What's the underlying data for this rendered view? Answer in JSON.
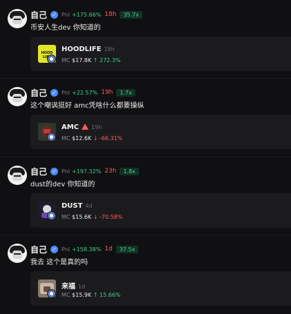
{
  "posts": [
    {
      "username": "自己",
      "pnl_label": "Pnl",
      "pnl": "+175.66%",
      "age": "18h",
      "multiplier": "35.7x",
      "message": "币安人生dev 你知道的",
      "token": {
        "name": "HOODLIFE",
        "age": "18h",
        "mc_label": "MC",
        "mc": "$17.8K",
        "change_arrow": "↑",
        "change": "272.3%",
        "direction": "up",
        "warning": false,
        "image_label": "HOOD LIFE"
      }
    },
    {
      "username": "自己",
      "pnl_label": "Pnl",
      "pnl": "+22.57%",
      "age": "19h",
      "multiplier": "1.7x",
      "message": "这个嘲讽挺好 amc凭啥什么都要操纵",
      "token": {
        "name": "AMC",
        "age": "19h",
        "mc_label": "MC",
        "mc": "$12.6K",
        "change_arrow": "↓",
        "change": "-66.31%",
        "direction": "down",
        "warning": true
      }
    },
    {
      "username": "自己",
      "pnl_label": "Pnl",
      "pnl": "+197.32%",
      "age": "23h",
      "multiplier": "1.8x",
      "message": "dust的dev 你知道的",
      "token": {
        "name": "DUST",
        "age": "4d",
        "mc_label": "MC",
        "mc": "$15.6K",
        "change_arrow": "↓",
        "change": "-70.58%",
        "direction": "down",
        "warning": false
      }
    },
    {
      "username": "自己",
      "pnl_label": "Pnl",
      "pnl": "+158.38%",
      "age": "1d",
      "multiplier": "37.5x",
      "message": "我去 这个是真的吗",
      "token": {
        "name": "来福",
        "age": "1d",
        "mc_label": "MC",
        "mc": "$15.9K",
        "change_arrow": "↑",
        "change": "15.66%",
        "direction": "up",
        "warning": false
      }
    }
  ]
}
